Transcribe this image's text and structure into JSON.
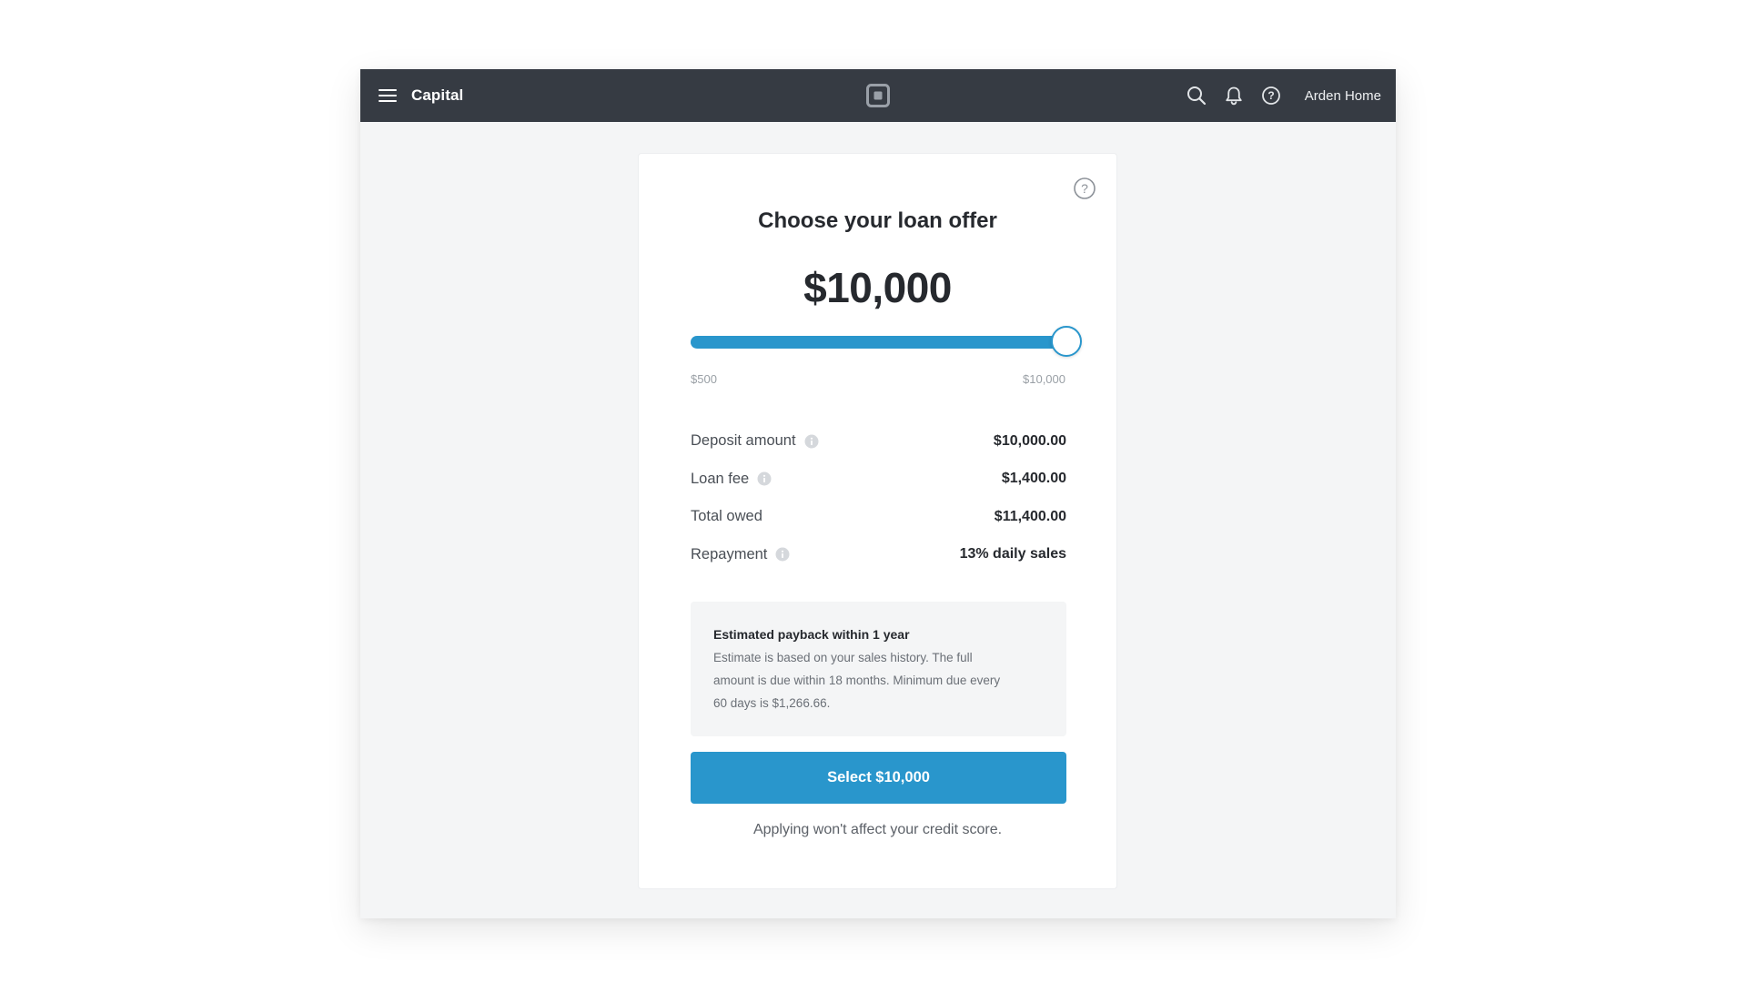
{
  "topbar": {
    "app_title": "Capital",
    "logo_icon": "square-logo",
    "icons": [
      "menu-icon",
      "search-icon",
      "bell-icon",
      "help-icon"
    ],
    "account_name": "Arden Home"
  },
  "card": {
    "title": "Choose your loan offer",
    "amount": "$10,000",
    "slider": {
      "min_label": "$500",
      "max_label": "$10,000",
      "min": 500,
      "max": 10000,
      "value": 10000
    },
    "details": [
      {
        "label": "Deposit amount",
        "value": "$10,000.00",
        "has_info": true
      },
      {
        "label": "Loan fee",
        "value": "$1,400.00",
        "has_info": true
      },
      {
        "label": "Total owed",
        "value": "$11,400.00",
        "has_info": false
      },
      {
        "label": "Repayment",
        "value": "13% daily sales",
        "has_info": true
      }
    ],
    "estimate": {
      "title": "Estimated payback within 1 year",
      "line1": "Estimate is based on your sales history. The full",
      "line2": "amount is due within 18 months. Minimum due every",
      "line3": "60 days is $1,266.66."
    },
    "select_button_label": "Select $10,000",
    "disclaimer": "Applying won't affect your credit score."
  },
  "colors": {
    "topbar_bg": "#363b43",
    "accent": "#2996cc",
    "page_bg": "#f4f5f6"
  }
}
